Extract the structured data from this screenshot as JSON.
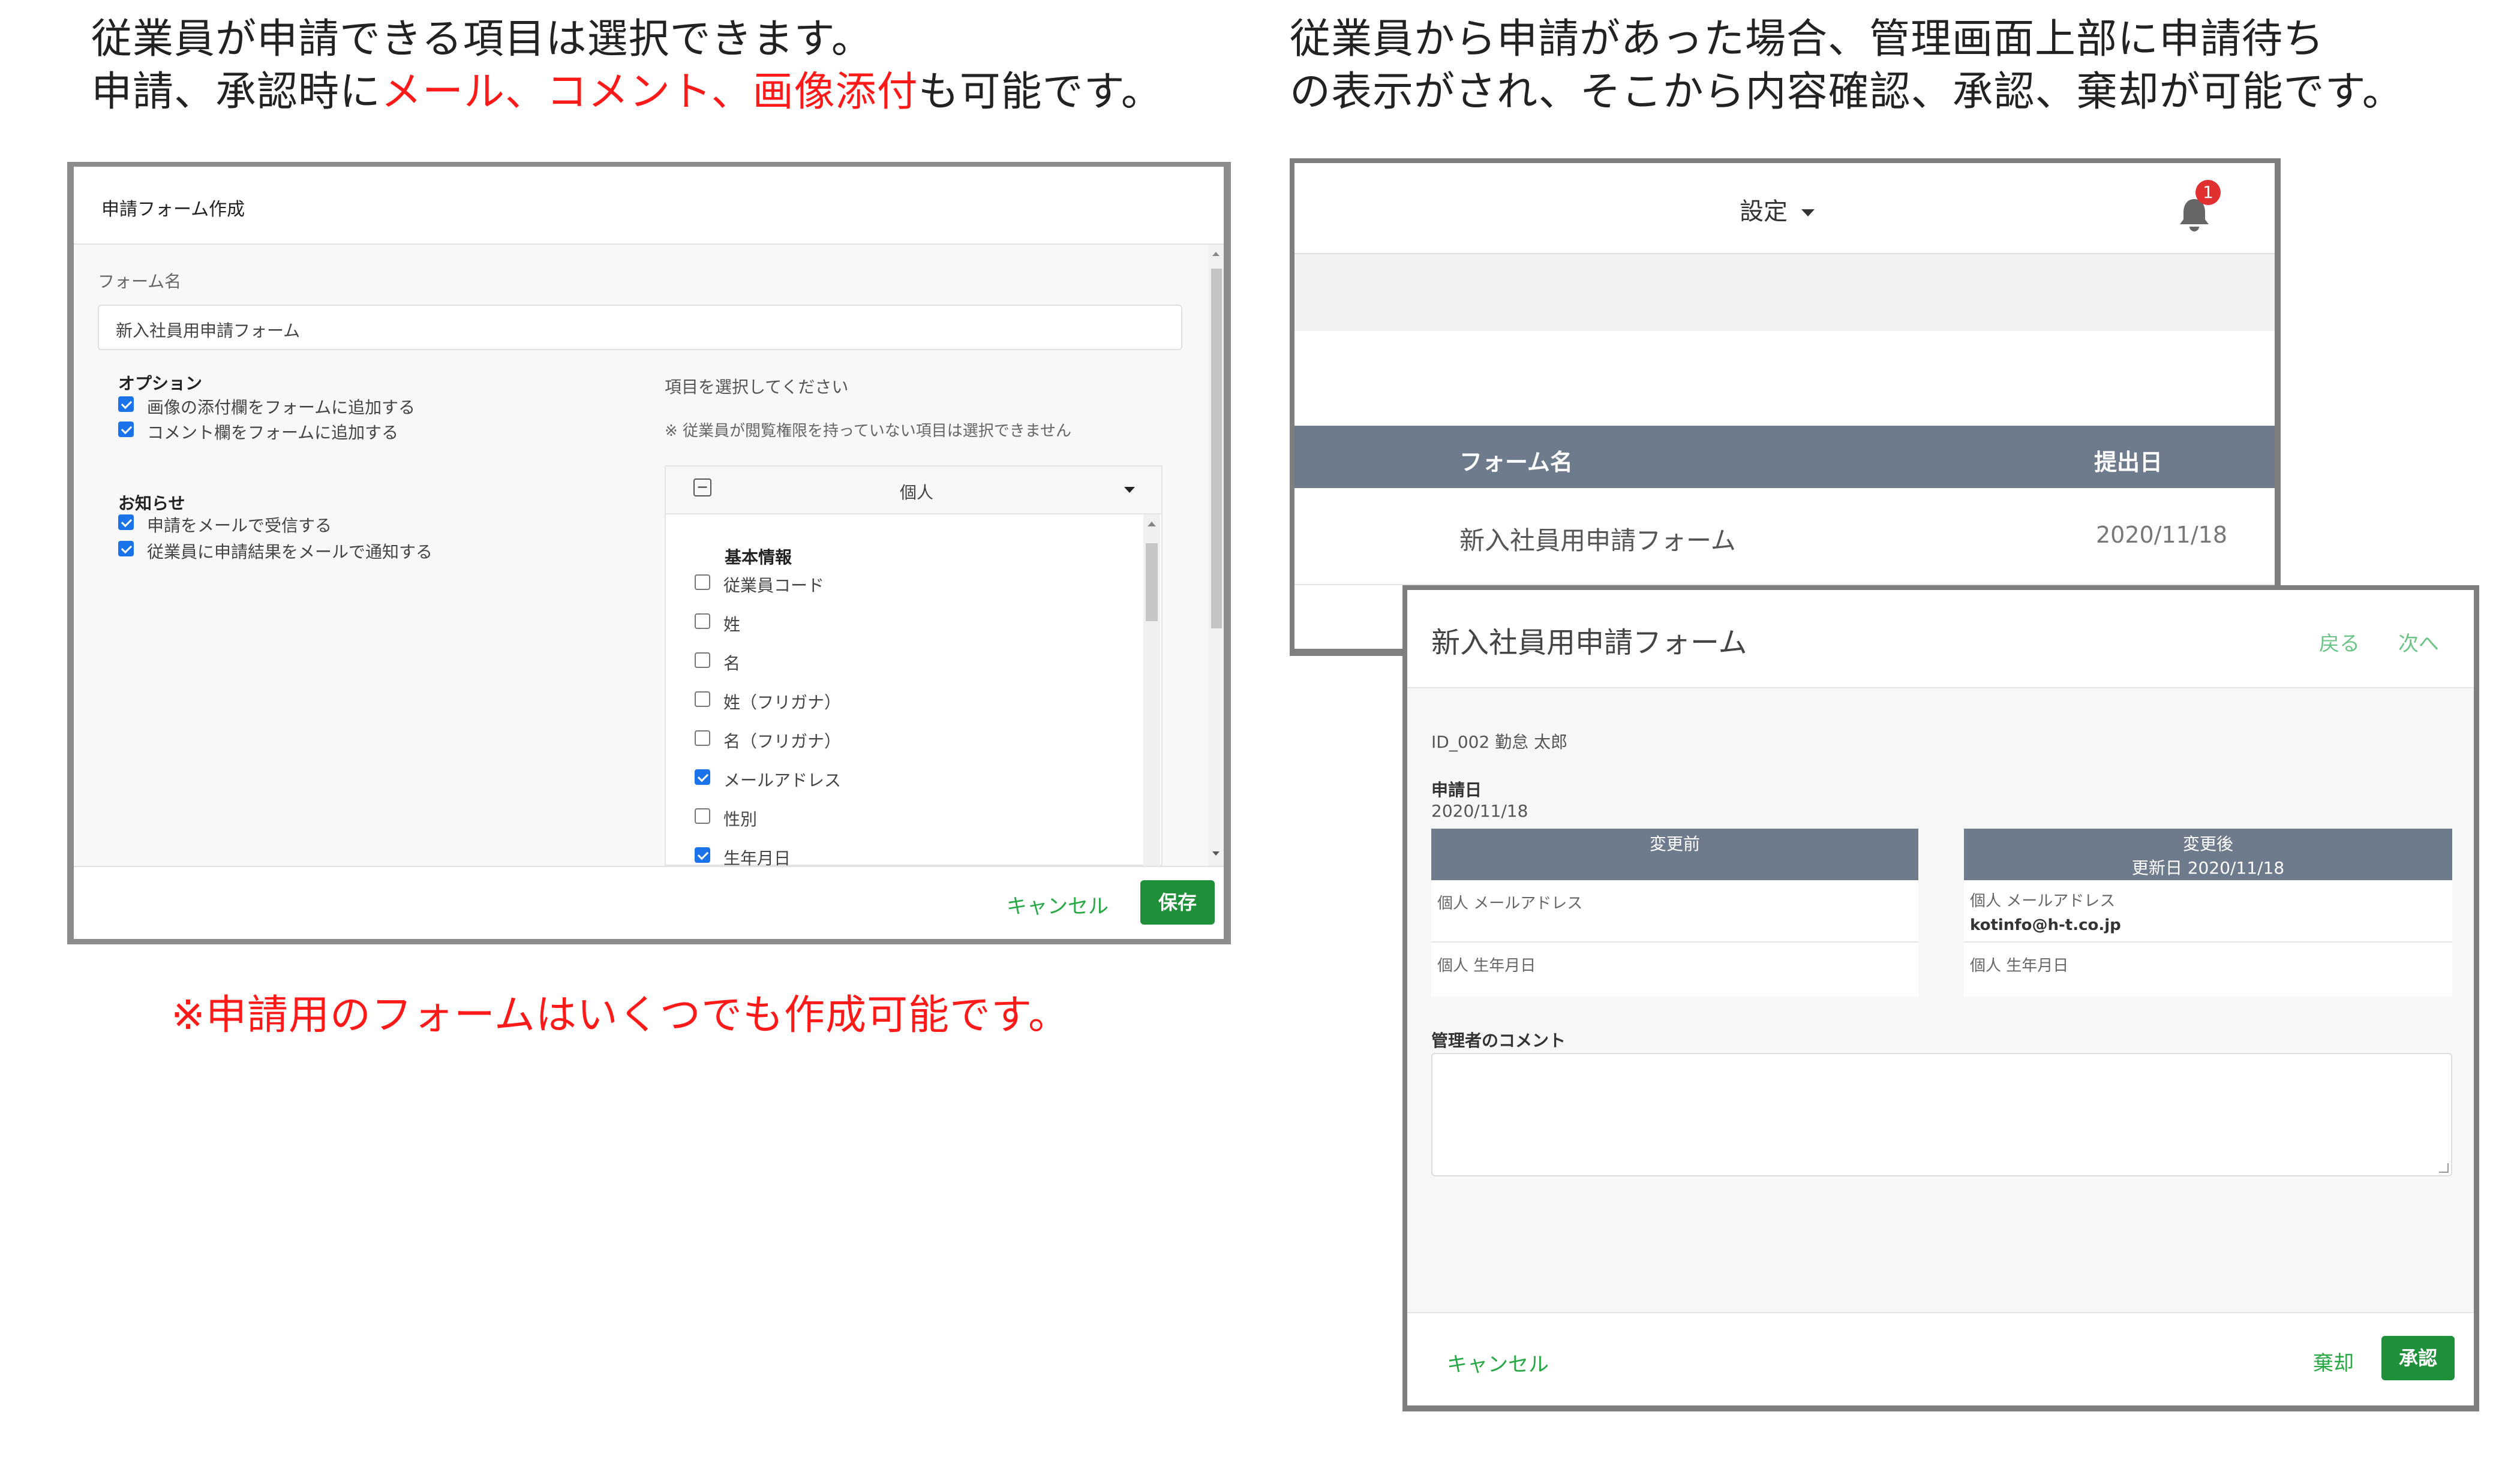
{
  "captions": {
    "left_line1": "従業員が申請できる項目は選択できます。",
    "left_line2_a": "申請、承認時に",
    "left_line2_red": "メール、コメント、画像添付",
    "left_line2_b": "も可能です。",
    "right_line1": "従業員から申請があった場合、管理画面上部に申請待ち",
    "right_line2": "の表示がされ、そこから内容確認、承認、棄却が可能です。",
    "note": "※申請用のフォームはいくつでも作成可能です。"
  },
  "form_builder": {
    "title": "申請フォーム作成",
    "form_name_label": "フォーム名",
    "form_name_value": "新入社員用申請フォーム",
    "options_heading": "オプション",
    "options": [
      {
        "label": "画像の添付欄をフォームに追加する",
        "checked": true
      },
      {
        "label": "コメント欄をフォームに追加する",
        "checked": true
      }
    ],
    "notice_heading": "お知らせ",
    "notices": [
      {
        "label": "申請をメールで受信する",
        "checked": true
      },
      {
        "label": "従業員に申請結果をメールで通知する",
        "checked": true
      }
    ],
    "select_label": "項目を選択してください",
    "select_note": "※ 従業員が閲覧権限を持っていない項目は選択できません",
    "section_toggle": "−",
    "section_name": "個人",
    "group_heading": "基本情報",
    "items": [
      {
        "label": "従業員コード",
        "checked": false
      },
      {
        "label": "姓",
        "checked": false
      },
      {
        "label": "名",
        "checked": false
      },
      {
        "label": "姓（フリガナ）",
        "checked": false
      },
      {
        "label": "名（フリガナ）",
        "checked": false
      },
      {
        "label": "メールアドレス",
        "checked": true
      },
      {
        "label": "性別",
        "checked": false
      },
      {
        "label": "生年月日",
        "checked": true
      }
    ],
    "cancel": "キャンセル",
    "save": "保存"
  },
  "admin_list": {
    "settings": "設定",
    "notification_count": "1",
    "col_form": "フォーム名",
    "col_date": "提出日",
    "row_form": "新入社員用申請フォーム",
    "row_date": "2020/11/18"
  },
  "review": {
    "title": "新入社員用申請フォーム",
    "back": "戻る",
    "next": "次へ",
    "applicant": "ID_002 勤怠 太郎",
    "date_label": "申請日",
    "date_value": "2020/11/18",
    "before_head": "変更前",
    "after_head": "変更後",
    "after_sub": "更新日 2020/11/18",
    "field_email": "個人 メールアドレス",
    "field_birth": "個人 生年月日",
    "after_email_value": "kotinfo@h-t.co.jp",
    "comment_label": "管理者のコメント",
    "cancel": "キャンセル",
    "reject": "棄却",
    "approve": "承認"
  },
  "colors": {
    "accent_red": "#ff1a1a",
    "green": "#1f8f3a",
    "slate": "#6e7b8d",
    "check_blue": "#1a73e8"
  }
}
